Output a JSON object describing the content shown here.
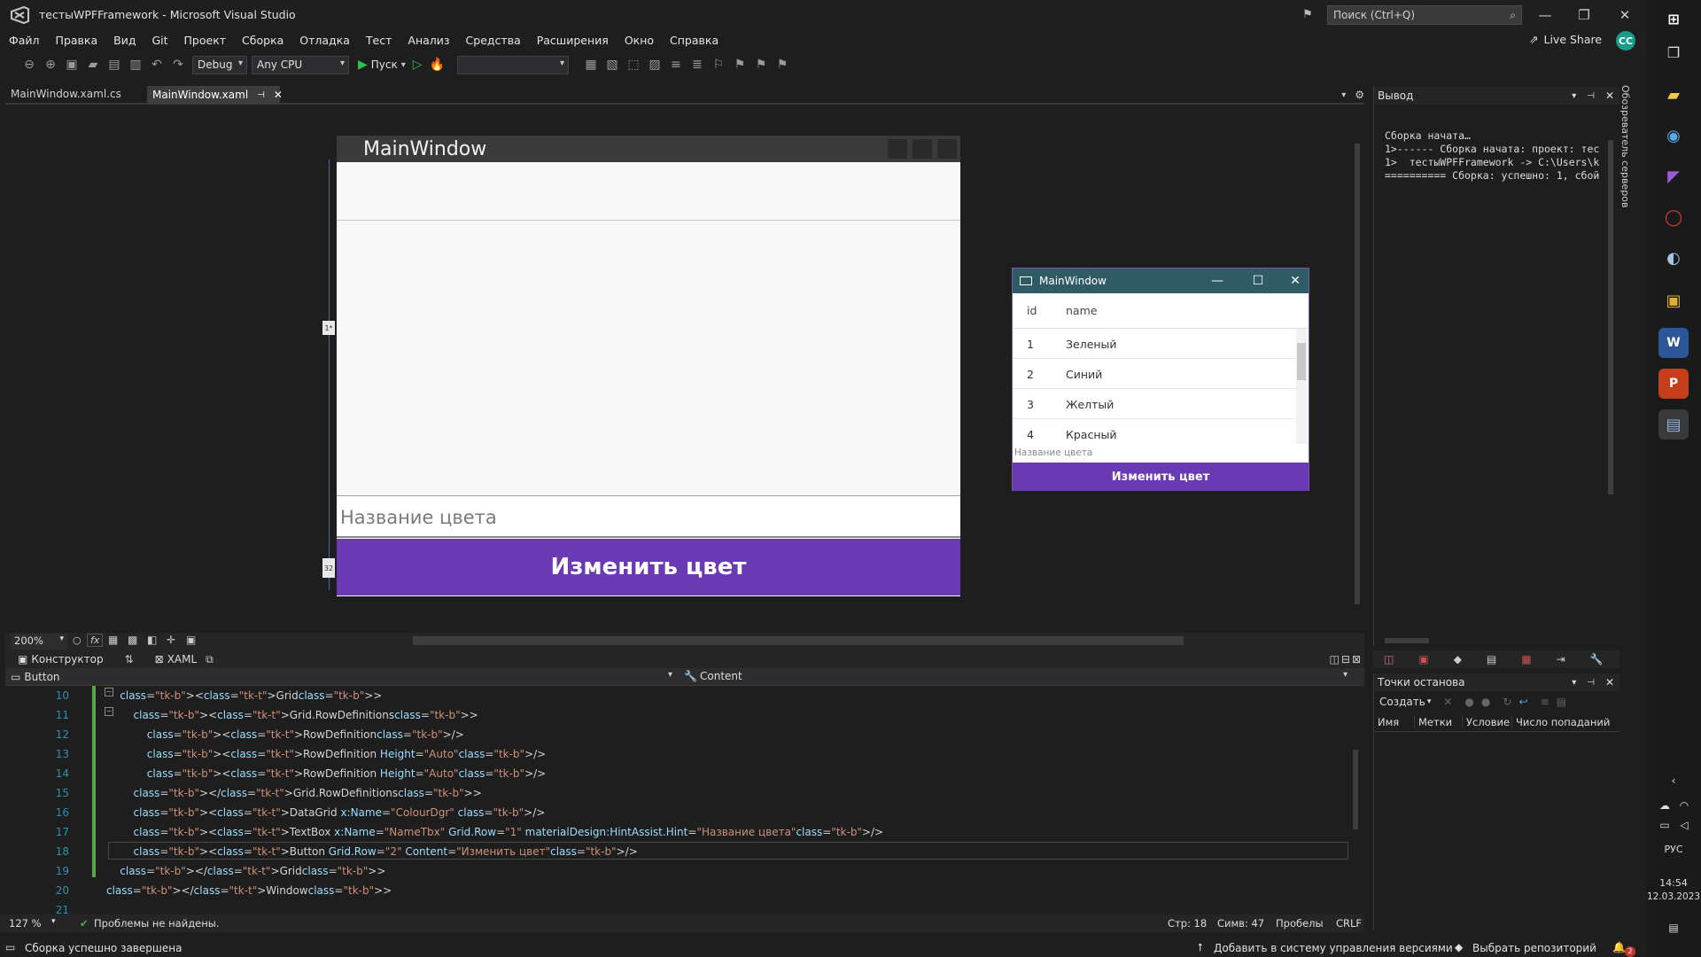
{
  "app": {
    "title": "тестыWPFFramework - Microsoft Visual Studio",
    "search_placeholder": "Поиск (Ctrl+Q)",
    "live_share": "Live Share",
    "avatar": "CC"
  },
  "menu": [
    "Файл",
    "Правка",
    "Вид",
    "Git",
    "Проект",
    "Сборка",
    "Отладка",
    "Тест",
    "Анализ",
    "Средства",
    "Расширения",
    "Окно",
    "Справка"
  ],
  "toolbar": {
    "config": "Debug",
    "platform": "Any CPU",
    "run_label": "Пуск"
  },
  "tabs": [
    {
      "label": "MainWindow.xaml.cs",
      "active": false
    },
    {
      "label": "MainWindow.xaml",
      "active": true
    }
  ],
  "designer": {
    "window_title": "MainWindow",
    "textbox_hint": "Название цвета",
    "button_label": "Изменить цвет",
    "grid_marker_1": "1*",
    "grid_marker_2": "32"
  },
  "running_window": {
    "title": "MainWindow",
    "columns": [
      "id",
      "name"
    ],
    "rows": [
      {
        "id": "1",
        "name": "Зеленый"
      },
      {
        "id": "2",
        "name": "Синий"
      },
      {
        "id": "3",
        "name": "Желтый"
      },
      {
        "id": "4",
        "name": "Красный"
      }
    ],
    "hint": "Название цвета",
    "button": "Изменить цвет"
  },
  "designer_bar": {
    "zoom": "200%",
    "fx": "fx",
    "tab_designer": "Конструктор",
    "tab_xaml": "XAML",
    "element": "Button",
    "property": "Content"
  },
  "code": {
    "lines": [
      {
        "n": "10",
        "text": "    <Grid>"
      },
      {
        "n": "11",
        "text": "        <Grid.RowDefinitions>"
      },
      {
        "n": "12",
        "text": "            <RowDefinition/>"
      },
      {
        "n": "13",
        "text": "            <RowDefinition Height=\"Auto\"/>"
      },
      {
        "n": "14",
        "text": "            <RowDefinition Height=\"Auto\"/>"
      },
      {
        "n": "15",
        "text": "        </Grid.RowDefinitions>"
      },
      {
        "n": "16",
        "text": "        <DataGrid x:Name=\"ColourDgr\" />"
      },
      {
        "n": "17",
        "text": "        <TextBox x:Name=\"NameTbx\" Grid.Row=\"1\" materialDesign:HintAssist.Hint=\"Название цвета\"/>"
      },
      {
        "n": "18",
        "text": "        <Button Grid.Row=\"2\" Content=\"Изменить цвет\"/>"
      },
      {
        "n": "19",
        "text": "    </Grid>"
      },
      {
        "n": "20",
        "text": "</Window>"
      },
      {
        "n": "21",
        "text": ""
      }
    ]
  },
  "editor_status": {
    "zoom": "127 %",
    "issues": "Проблемы не найдены.",
    "line": "Стр: 18",
    "col": "Симв: 47",
    "spaces": "Пробелы",
    "eol": "CRLF"
  },
  "status_bar": {
    "message": "Сборка успешно завершена",
    "add_to_vcs": "Добавить в систему управления версиями",
    "select_repo": "Выбрать репозиторий",
    "notifications": "2"
  },
  "output": {
    "title": "Вывод",
    "lines": [
      "Сборка начата…",
      "1>------ Сборка начата: проект: тес",
      "1>  тестыWPFFramework -> C:\\Users\\k",
      "========== Сборка: успешно: 1, сбой"
    ]
  },
  "server_explorer": "Обозреватель серверов",
  "breakpoints": {
    "title": "Точки останова",
    "create": "Создать",
    "columns": [
      "Имя",
      "Метки",
      "Условие",
      "Число попаданий"
    ]
  },
  "taskbar": {
    "lang": "РУС",
    "time": "14:54",
    "date": "12.03.2023"
  }
}
